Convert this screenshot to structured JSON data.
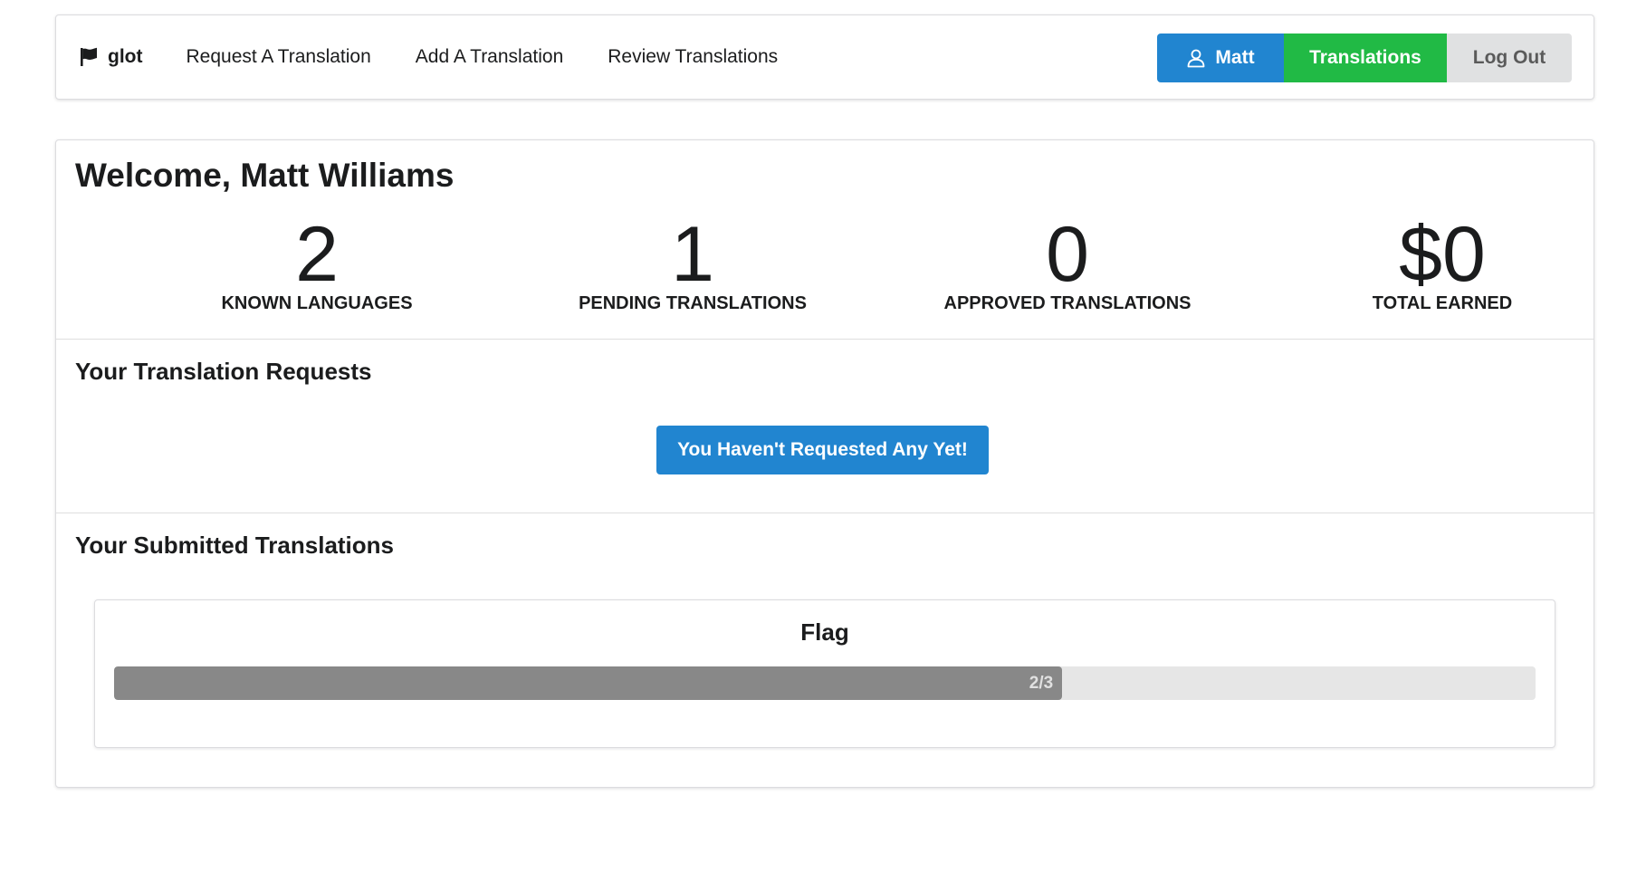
{
  "nav": {
    "brand": "glot",
    "items": [
      "Request A Translation",
      "Add A Translation",
      "Review Translations"
    ],
    "user_button": "Matt",
    "translations_button": "Translations",
    "logout_button": "Log Out"
  },
  "main": {
    "welcome": "Welcome, Matt Williams",
    "stats": [
      {
        "value": "2",
        "label": "KNOWN LANGUAGES"
      },
      {
        "value": "1",
        "label": "PENDING TRANSLATIONS"
      },
      {
        "value": "0",
        "label": "APPROVED TRANSLATIONS"
      },
      {
        "value": "$0",
        "label": "TOTAL EARNED"
      }
    ],
    "requests_title": "Your Translation Requests",
    "requests_empty_button": "You Haven't Requested Any Yet!",
    "submitted_title": "Your Submitted Translations",
    "submitted": [
      {
        "title": "Flag",
        "progress_label": "2/3",
        "progress_fraction": 0.667
      }
    ]
  },
  "colors": {
    "primary_blue": "#2185d0",
    "green": "#21ba45",
    "grey_button": "#e0e1e2",
    "progress_fill": "#888888"
  },
  "icons": {
    "brand": "flag-icon",
    "user": "user-icon"
  }
}
